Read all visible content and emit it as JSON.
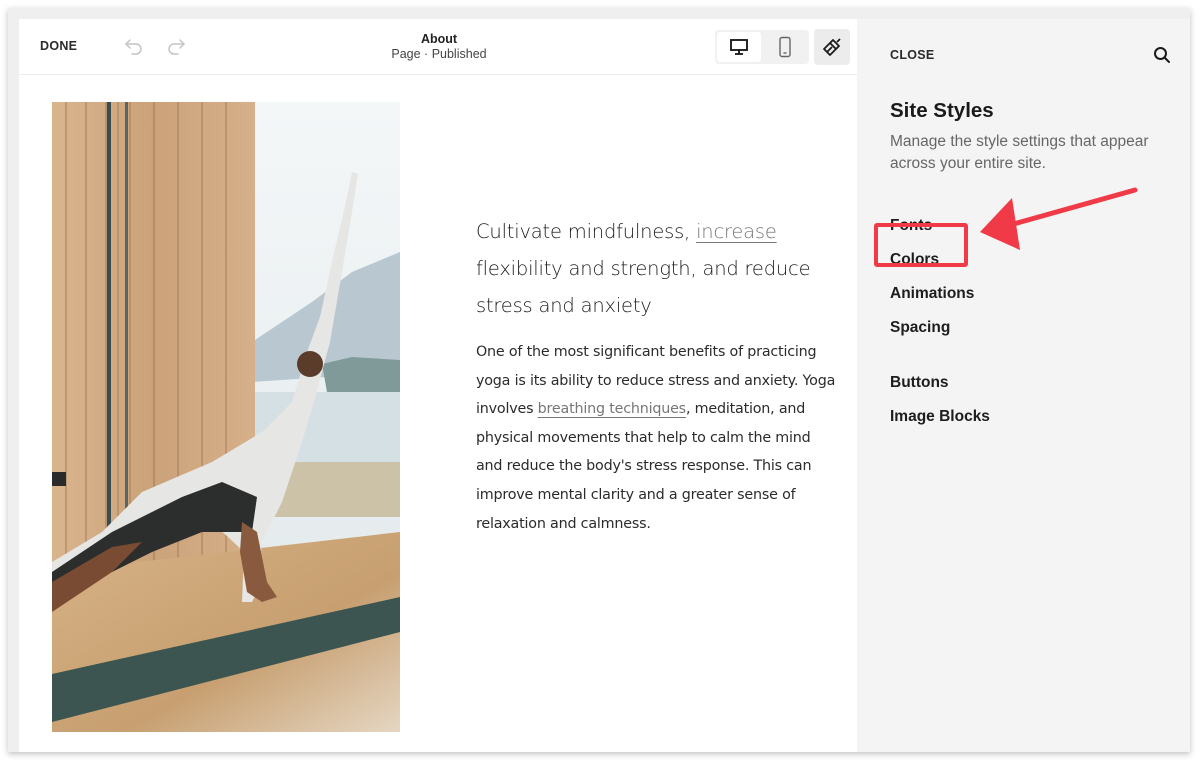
{
  "topbar": {
    "done_label": "DONE",
    "undo_icon": "undo-icon",
    "redo_icon": "redo-icon",
    "page_title": "About",
    "page_status": "Page · Published",
    "device_options": [
      "desktop",
      "mobile"
    ],
    "selected_device": "desktop",
    "style_icon": "paintbrush-icon"
  },
  "content": {
    "image_alt": "Man in a side-angle yoga pose on a green mat beside a wooden wall and a window overlooking mountains and a lake",
    "headline": {
      "before": "Cultivate mindfulness, ",
      "link": "increase",
      "after": " flexibility and strength, and reduce stress and anxiety"
    },
    "body": {
      "before": "One of the most significant benefits of practicing yoga is its ability to reduce stress and anxiety. Yoga involves ",
      "link": "breathing techniques",
      "after": ", meditation, and physical movements that help to calm the mind and reduce the body's stress response. This can improve mental clarity and a greater sense of relaxation and calmness."
    }
  },
  "panel": {
    "close_label": "CLOSE",
    "search_icon": "search-icon",
    "title": "Site Styles",
    "description": "Manage the style settings that appear across your entire site.",
    "items": [
      {
        "label": "Fonts"
      },
      {
        "label": "Colors",
        "highlighted": true
      },
      {
        "label": "Animations"
      },
      {
        "label": "Spacing"
      },
      {
        "label": "Buttons"
      },
      {
        "label": "Image Blocks"
      }
    ]
  },
  "annotation": {
    "color": "#f03a47",
    "target": "Colors"
  }
}
